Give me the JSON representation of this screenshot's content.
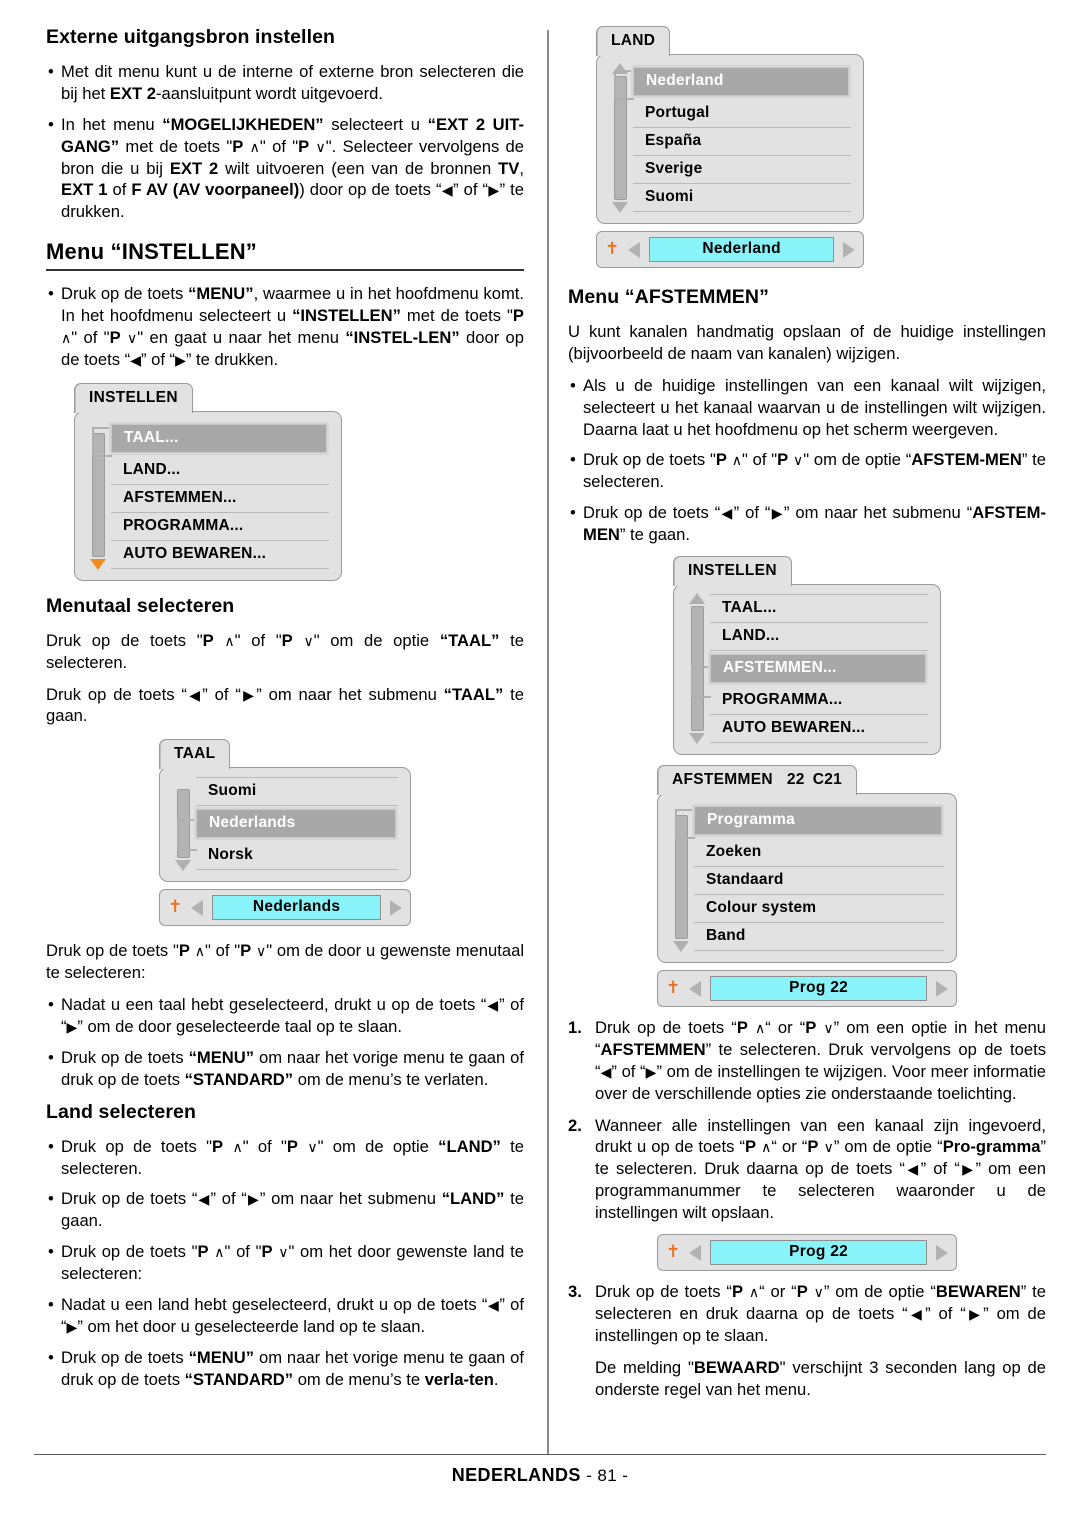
{
  "left": {
    "heading_ext_source": "Externe uitgangsbron instellen",
    "bullets_ext": [
      "Met dit menu kunt u de interne of externe bron selecteren die bij het EXT 2-aansluitpunt wordt uitgevoerd.",
      "In het menu “MOGELIJKHEDEN” selecteert u “EXT 2 UITGANG” met de toets \"P ∧\" of \"P ∨\". Selecteer vervolgens de bron die u bij EXT 2 wilt uitvoeren (een van de bronnen TV, EXT 1 of F AV (AV voorpaneel)) door op de toets “◀” of “▶” te drukken."
    ],
    "heading_menu_instellen": "Menu “INSTELLEN”",
    "bullet_instellen": "Druk op de toets “MENU”, waarmee u in het hoofdmenu komt. In het hoofdmenu selecteert u “INSTELLEN” met de toets \"P ∧\" of \"P ∨\" en gaat u naar het menu “INSTELLEN” door op de toets “◀” of “▶” te drukken.",
    "heading_menutaal": "Menutaal selecteren",
    "para_taal_1": "Druk op de toets \"P ∧\" of \"P ∨\" om de optie “TAAL” te selecteren.",
    "para_taal_2": "Druk op de toets “◀” of “▶” om naar het submenu “TAAL” te gaan.",
    "para_taal_3": "Druk op de toets \"P ∧\" of \"P ∨\" om de door u gewenste menutaal te selecteren:",
    "bullets_taal": [
      "Nadat u een taal hebt geselecteerd, drukt u op de toets “◀” of “▶” om de door geselecteerde taal op te slaan.",
      "Druk op de toets “MENU” om naar het vorige menu te gaan of druk op de toets “STANDARD” om de menu’s te verlaten."
    ],
    "heading_land": "Land selecteren",
    "bullets_land": [
      "Druk op de toets \"P ∧\" of \"P ∨\" om de optie “LAND” te selecteren.",
      "Druk op de toets “◀” of “▶” om naar het submenu “LAND” te gaan.",
      "Druk op de toets \"P ∧\" of \"P ∨\" om het door gewenste land te selecteren:",
      "Nadat u een land hebt geselecteerd, drukt u op de toets “◀” of “▶” om het door u geselecteerde land op te slaan.",
      "Druk op de toets “MENU” om naar het vorige menu te gaan of druk op de toets “STANDARD” om de menu’s te verlaten."
    ]
  },
  "right": {
    "heading_afstemmen": "Menu “AFSTEMMEN”",
    "para_afstemmen": "U kunt kanalen handmatig opslaan of de huidige instellingen (bijvoorbeeld de naam van kanalen) wijzigen.",
    "bullets_afstemmen": [
      "Als u de huidige instellingen van een kanaal wilt wijzigen, selecteert u het kanaal waarvan u de instellingen wilt wijzigen. Daarna laat u het hoofdmenu op het scherm weergeven.",
      "Druk op de toets \"P ∧\" of \"P ∨\" om de optie “AFSTEMMEN” te selecteren.",
      "Druk op de toets “◀” of “▶” om naar het submenu “AFSTEMMEN” te gaan."
    ],
    "numbered": [
      "Druk op de toets “P ∧“ or “P ∨” om een optie in het menu “AFSTEMMEN” te selecteren. Druk vervolgens op de toets “◀” of “▶” om de instellingen te wijzigen. Voor meer informatie over de verschillende opties zie onderstaande toelichting.",
      "Wanneer alle instellingen van een kanaal zijn ingevoerd, drukt u op de toets “P ∧“ or “P ∨” om de optie “Programma” te selecteren. Druk daarna op de toets “◀” of “▶” om een programmanummer te selecteren waaronder u de instellingen wilt opslaan.",
      "Druk op de toets “P ∧“ or “P ∨” om de optie “BEWAREN” te selecteren en druk daarna op de toets “◀” of “▶” om de instellingen op te slaan."
    ],
    "note_bewaard": "De melding \"BEWAARD\" verschijnt 3 seconden lang op de onderste regel van het menu."
  },
  "osd": {
    "instellen_1": {
      "tab": "INSTELLEN",
      "items": [
        "TAAL...",
        "LAND...",
        "AFSTEMMEN...",
        "PROGRAMMA...",
        "AUTO BEWAREN..."
      ],
      "selected_index": 0,
      "arrow_down_color": "#f08c1b"
    },
    "taal": {
      "tab": "TAAL",
      "items": [
        "Suomi",
        "Nederlands",
        "Norsk"
      ],
      "selected_index": 1,
      "status_value": "Nederlands"
    },
    "land": {
      "tab": "LAND",
      "items": [
        "Nederland",
        "Portugal",
        "España",
        "Sverige",
        "Suomi"
      ],
      "selected_index": 0,
      "status_value": "Nederland"
    },
    "instellen_2": {
      "tab": "INSTELLEN",
      "items": [
        "TAAL...",
        "LAND...",
        "AFSTEMMEN...",
        "PROGRAMMA...",
        "AUTO BEWAREN..."
      ],
      "selected_index": 2
    },
    "afstemmen": {
      "tab": "AFSTEMMEN",
      "tab_num": "22",
      "tab_chan": "C21",
      "items": [
        "Programma",
        "Zoeken",
        "Standaard",
        "Colour system",
        "Band"
      ],
      "selected_index": 0,
      "status_value": "Prog  22"
    },
    "prog_status": {
      "status_value": "Prog  22"
    },
    "icons": {
      "wrench": "wrench-icon",
      "left_arrow": "left-triangle-icon",
      "right_arrow": "right-triangle-icon"
    },
    "colors": {
      "panel": "#e2e2e2",
      "highlight": "#a8a8a8",
      "cyan": "#88f3f8",
      "orange": "#f0701a"
    }
  },
  "footer": {
    "language": "NEDERLANDS",
    "page": "- 81 -"
  }
}
